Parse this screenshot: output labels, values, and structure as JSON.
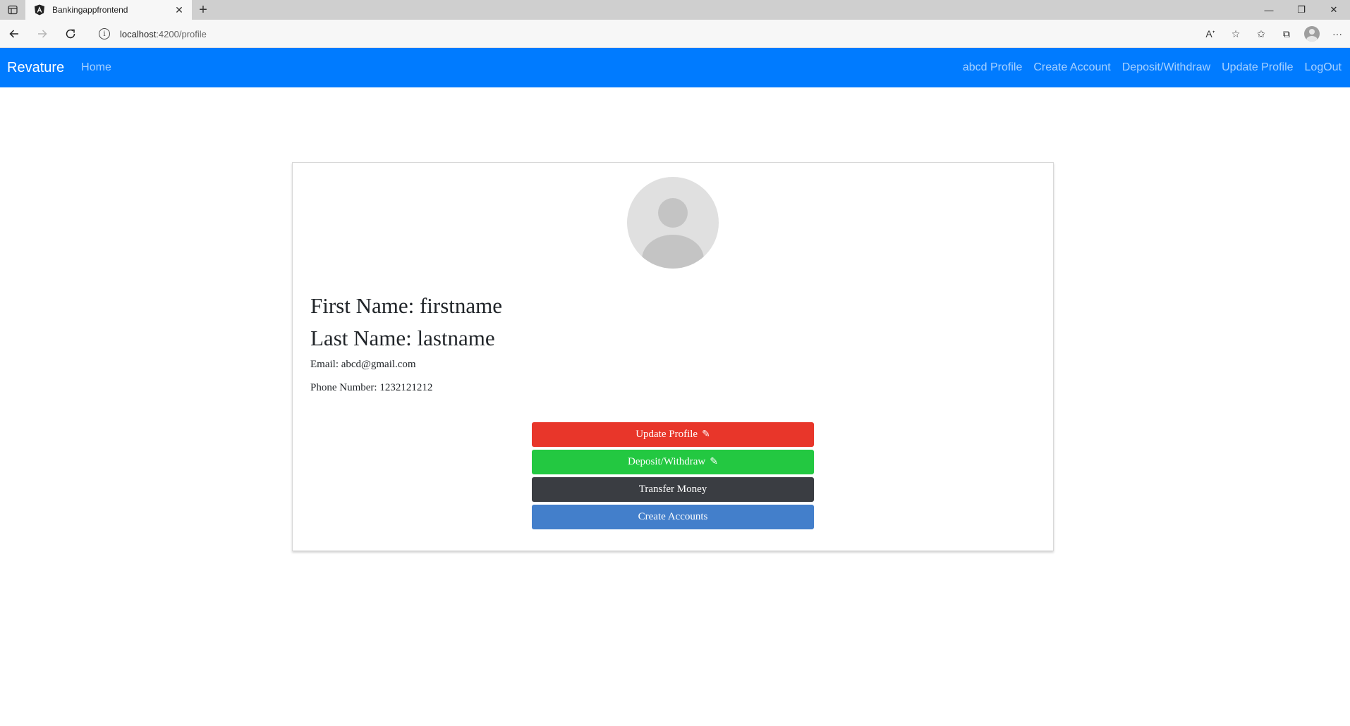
{
  "browser": {
    "tab_title": "Bankingappfrontend",
    "url_host": "localhost",
    "url_path": ":4200/profile"
  },
  "navbar": {
    "brand": "Revature",
    "home": "Home",
    "links": {
      "profile": "abcd Profile",
      "create_account": "Create Account",
      "deposit_withdraw": "Deposit/Withdraw",
      "update_profile": "Update Profile",
      "logout": "LogOut"
    },
    "color": "#007bff"
  },
  "profile": {
    "first_name": "First Name: firstname",
    "last_name": "Last Name: lastname",
    "email": "Email: abcd@gmail.com",
    "phone": "Phone Number: 1232121212"
  },
  "actions": {
    "update_profile": "Update Profile",
    "deposit_withdraw": "Deposit/Withdraw",
    "transfer_money": "Transfer Money",
    "create_accounts": "Create Accounts",
    "pencil_glyph": "✎"
  },
  "colors": {
    "update_profile": "#e8362a",
    "deposit_withdraw": "#23c841",
    "transfer_money": "#3a3d42",
    "create_accounts": "#437fcb"
  }
}
